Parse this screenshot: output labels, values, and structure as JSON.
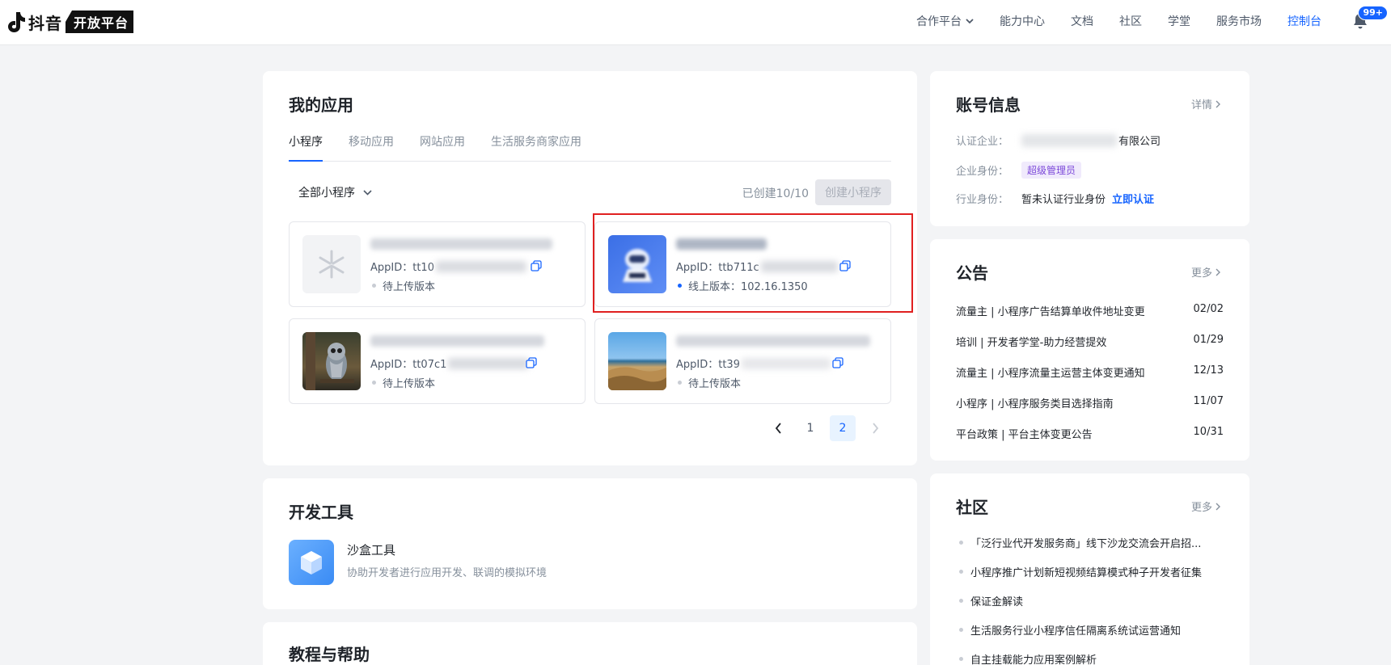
{
  "header": {
    "logo_text": "抖音",
    "logo_badge": "开放平台",
    "nav": [
      {
        "label": "合作平台",
        "has_dropdown": true
      },
      {
        "label": "能力中心"
      },
      {
        "label": "文档"
      },
      {
        "label": "社区"
      },
      {
        "label": "学堂"
      },
      {
        "label": "服务市场"
      },
      {
        "label": "控制台",
        "active": true
      }
    ],
    "notification_count": "99+"
  },
  "my_apps": {
    "title": "我的应用",
    "tabs": [
      {
        "label": "小程序",
        "active": true
      },
      {
        "label": "移动应用"
      },
      {
        "label": "网站应用"
      },
      {
        "label": "生活服务商家应用"
      }
    ],
    "filter_label": "全部小程序",
    "created_count": "已创建10/10",
    "create_button": "创建小程序",
    "apps": [
      {
        "appid_prefix": "AppID：tt10",
        "status": "待上传版本",
        "online": false,
        "icon": "placeholder-app-icon"
      },
      {
        "appid_prefix": "AppID：ttb711c",
        "status": "线上版本：102.16.1350",
        "online": true,
        "icon": "robot-app-icon"
      },
      {
        "appid_prefix": "AppID：tt07c1",
        "status": "待上传版本",
        "online": false,
        "icon": "owl-photo-icon"
      },
      {
        "appid_prefix": "AppID：tt39",
        "status": "待上传版本",
        "online": false,
        "icon": "beach-photo-icon"
      }
    ],
    "pagination": {
      "pages": [
        "1",
        "2"
      ],
      "current": "2"
    }
  },
  "dev_tools": {
    "title": "开发工具",
    "items": [
      {
        "name": "沙盒工具",
        "desc": "协助开发者进行应用开发、联调的模拟环境"
      }
    ]
  },
  "help": {
    "title": "教程与帮助"
  },
  "account": {
    "title": "账号信息",
    "detail_link": "详情",
    "company_label": "认证企业：",
    "company_suffix": "有限公司",
    "role_label": "企业身份：",
    "role_value": "超级管理员",
    "industry_label": "行业身份：",
    "industry_value": "暂未认证行业身份",
    "verify_link": "立即认证"
  },
  "notice": {
    "title": "公告",
    "more": "更多",
    "items": [
      {
        "text": "流量主 | 小程序广告结算单收件地址变更",
        "date": "02/02"
      },
      {
        "text": "培训 | 开发者学堂-助力经营提效",
        "date": "01/29"
      },
      {
        "text": "流量主 | 小程序流量主运营主体变更通知",
        "date": "12/13"
      },
      {
        "text": "小程序 | 小程序服务类目选择指南",
        "date": "11/07"
      },
      {
        "text": "平台政策 | 平台主体变更公告",
        "date": "10/31"
      }
    ]
  },
  "community": {
    "title": "社区",
    "more": "更多",
    "items": [
      {
        "text": "「泛行业代开发服务商」线下沙龙交流会开启招..."
      },
      {
        "text": "小程序推广计划新短视频结算模式种子开发者征集"
      },
      {
        "text": "保证金解读"
      },
      {
        "text": "生活服务行业小程序信任隔离系统试运营通知"
      },
      {
        "text": "自主挂载能力应用案例解析"
      }
    ]
  },
  "colors": {
    "accent": "#1664ff",
    "highlight": "#e02020",
    "role_badge": "#7c49d9"
  }
}
